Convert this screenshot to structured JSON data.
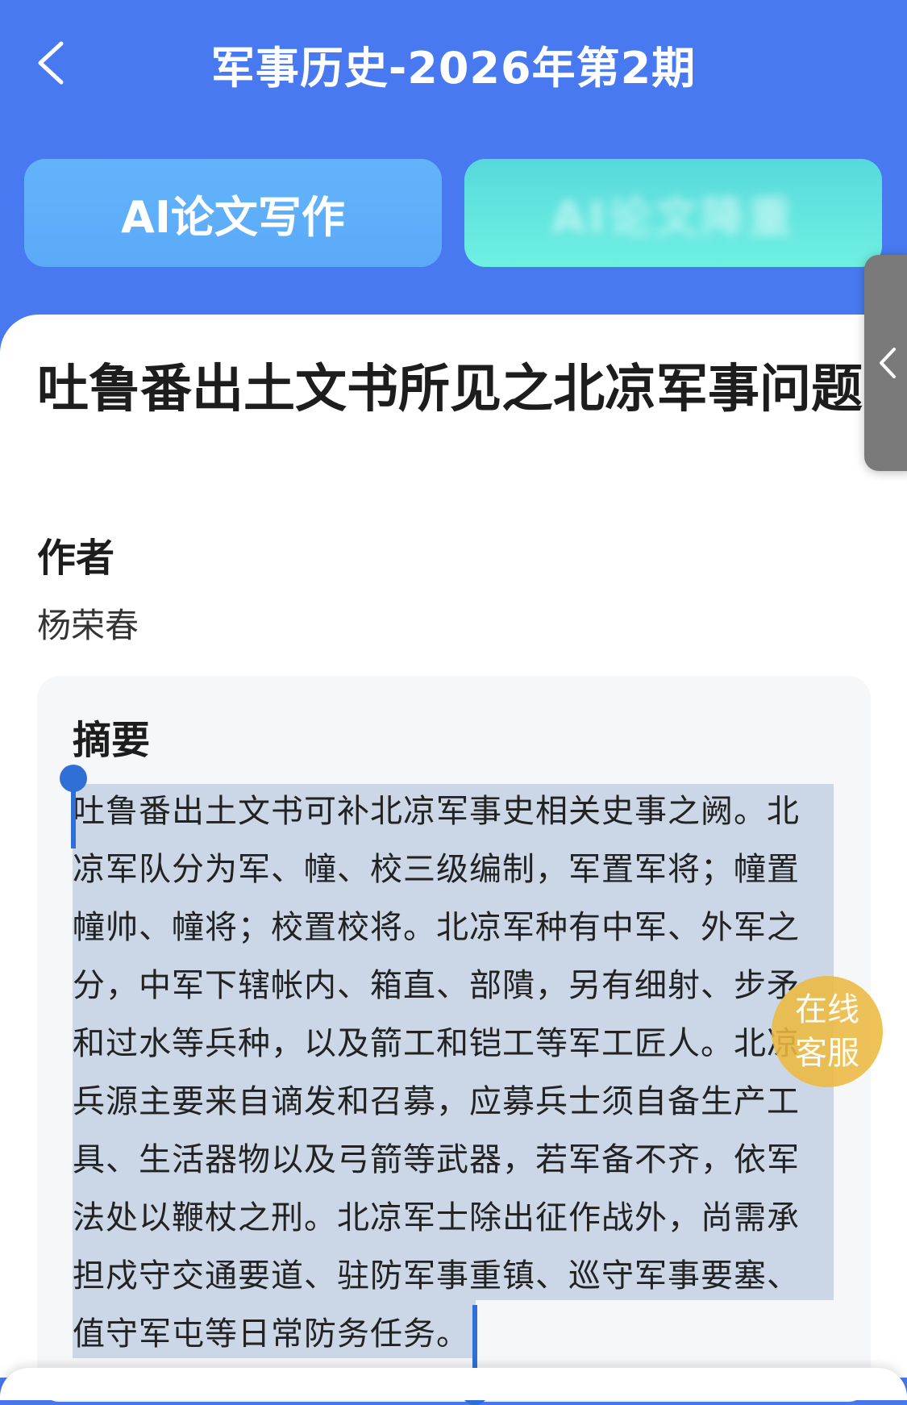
{
  "nav": {
    "title": "军事历史-2026年第2期"
  },
  "actions": {
    "ai_label": "AI论文写作",
    "other_label": "AI论文降重"
  },
  "article": {
    "title": "吐鲁番出土文书所见之北凉军事问题",
    "author_label": "作者",
    "author_name": "杨荣春",
    "abstract_label": "摘要",
    "abstract_text": "吐鲁番出土文书可补北凉军事史相关史事之阙。北凉军队分为军、幢、校三级编制，军置军将；幢置幢帅、幢将；校置校将。北凉军种有中军、外军之分，中军下辖帐内、箱直、部隤，另有细射、步矛和过水等兵种，以及箭工和铠工等军工匠人。北凉兵源主要来自谪发和召募，应募兵士须自备生产工具、生活器物以及弓箭等武器，若军备不齐，依军法处以鞭杖之刑。北凉军士除出征作战外，尚需承担戍守交通要道、驻防军事重镇、巡守军事要塞、值守军屯等日常防务任务。"
  },
  "service": {
    "line1": "在线",
    "line2": "客服"
  },
  "colors": {
    "header_bg": "#4879f0",
    "selection": "#cbd7e6",
    "cursor": "#2f6fd6",
    "service_bubble": "#ecb940"
  }
}
